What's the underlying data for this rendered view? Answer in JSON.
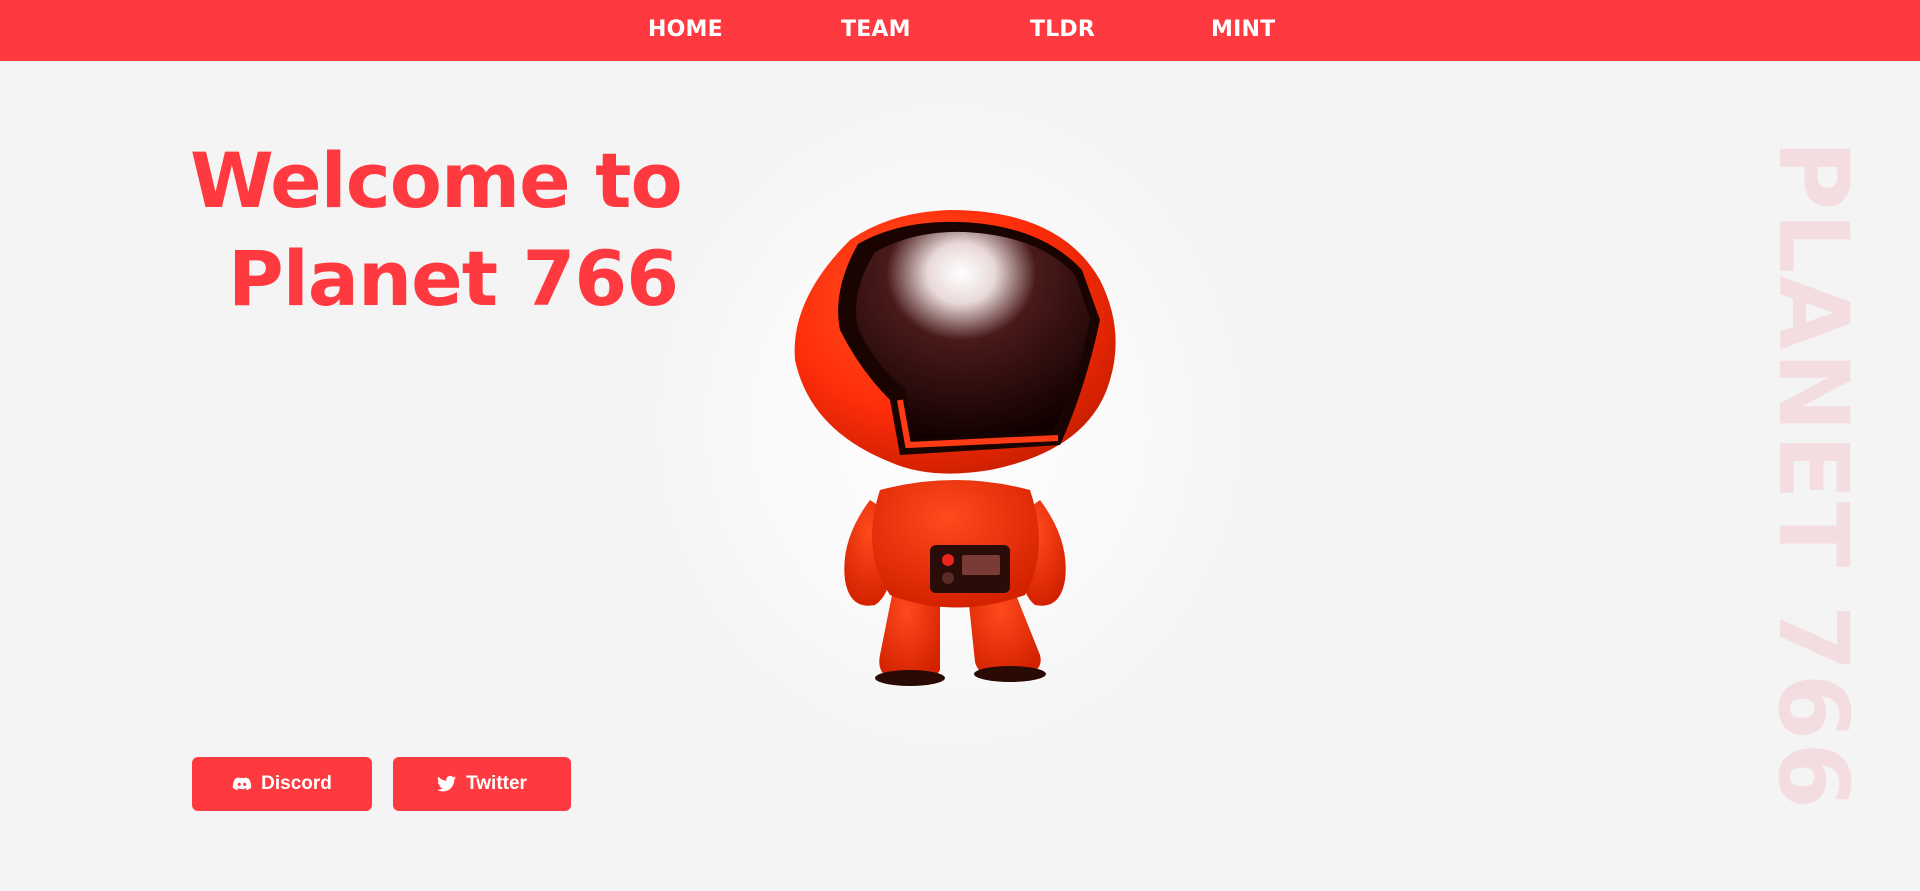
{
  "nav": {
    "items": [
      {
        "label": "HOME"
      },
      {
        "label": "TEAM"
      },
      {
        "label": "TLDR"
      },
      {
        "label": "MINT"
      }
    ]
  },
  "hero": {
    "title_line1": "Welcome to",
    "title_line2": "Planet 766"
  },
  "side_text": "PLANET 766",
  "social": {
    "discord_label": "Discord",
    "twitter_label": "Twitter"
  },
  "colors": {
    "brand_red": "#fe3a40",
    "background": "#f5f4f4",
    "side_text": "#f4dde0"
  },
  "icons": [
    "discord-icon",
    "twitter-icon"
  ]
}
